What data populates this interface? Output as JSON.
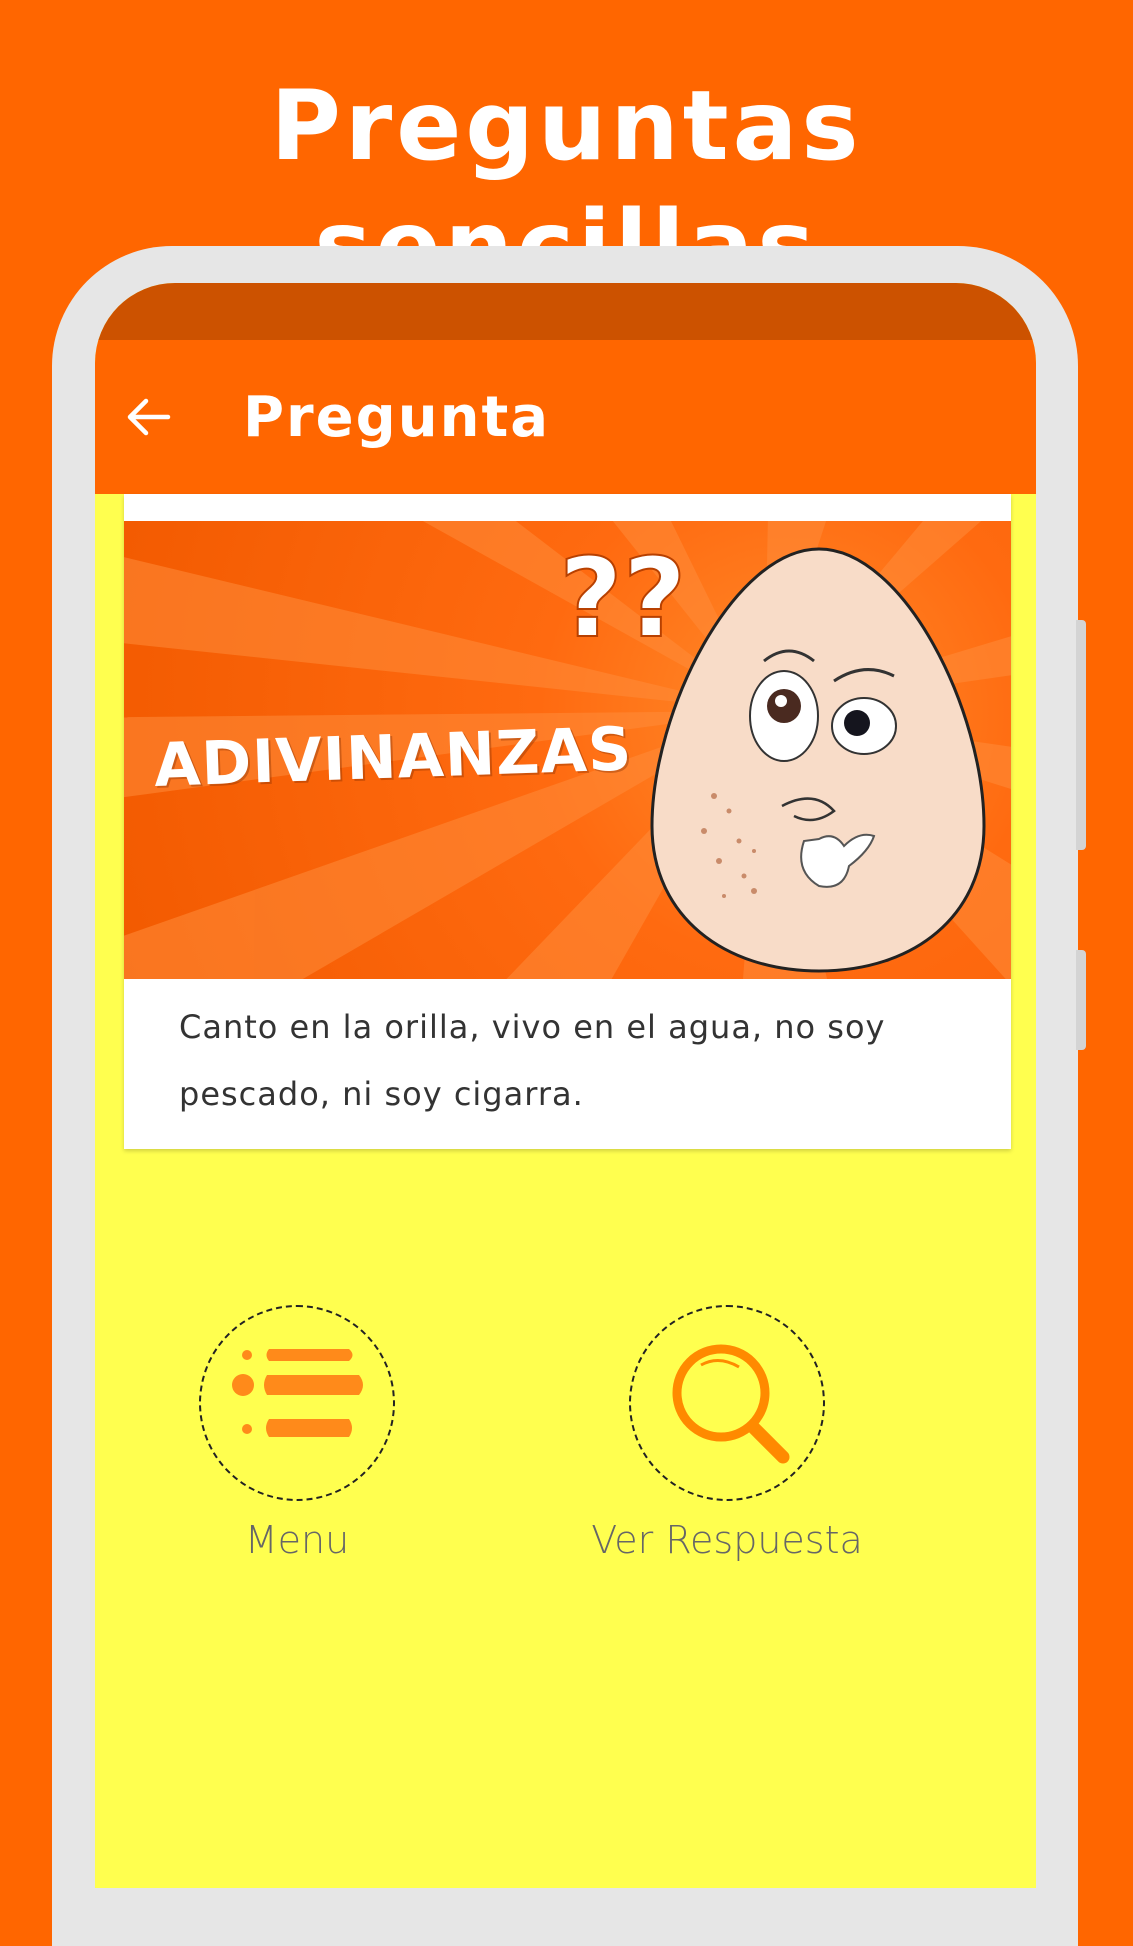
{
  "promo": {
    "title": "Preguntas sencillas"
  },
  "toolbar": {
    "title": "Pregunta",
    "back_icon": "arrow-left-icon"
  },
  "card": {
    "banner_text": "ADIVINANZAS",
    "banner_marks": "??",
    "riddle_text": "Canto en la orilla, vivo en el agua, no soy pescado, ni soy cigarra."
  },
  "actions": [
    {
      "label": "Menu",
      "icon": "menu-list-icon"
    },
    {
      "label": "Ver Respuesta",
      "icon": "magnifier-icon"
    }
  ],
  "colors": {
    "background": "#FF6600",
    "status_bar": "#CC5200",
    "toolbar": "#FF6600",
    "screen": "#FFFF4F",
    "icon_accent": "#FF8A00"
  }
}
